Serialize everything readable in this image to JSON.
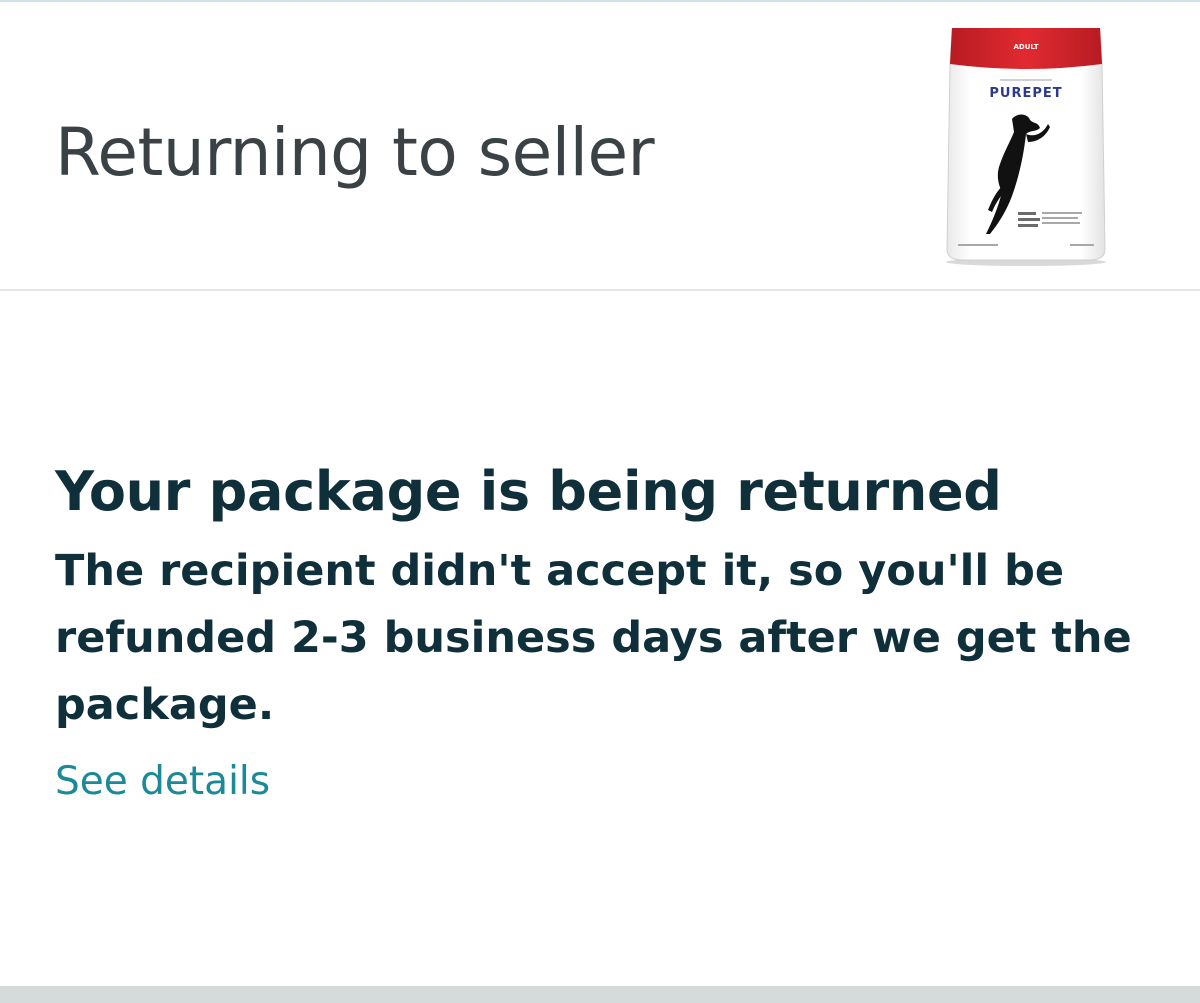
{
  "header": {
    "title": "Returning to seller",
    "product_image": {
      "label_top": "ADULT",
      "brand": "PUREPET",
      "accent_color": "#d8232a"
    }
  },
  "status": {
    "heading": "Your package is being returned",
    "message": "The recipient didn't accept it, so you'll be refunded 2-3 business days after we get the package.",
    "link_label": "See details"
  },
  "colors": {
    "title_text": "#3b4245",
    "heading_text": "#0f2f3a",
    "link": "#1a8a99",
    "divider": "#e3e6e6",
    "bottom_bar": "#d5dbdb"
  }
}
